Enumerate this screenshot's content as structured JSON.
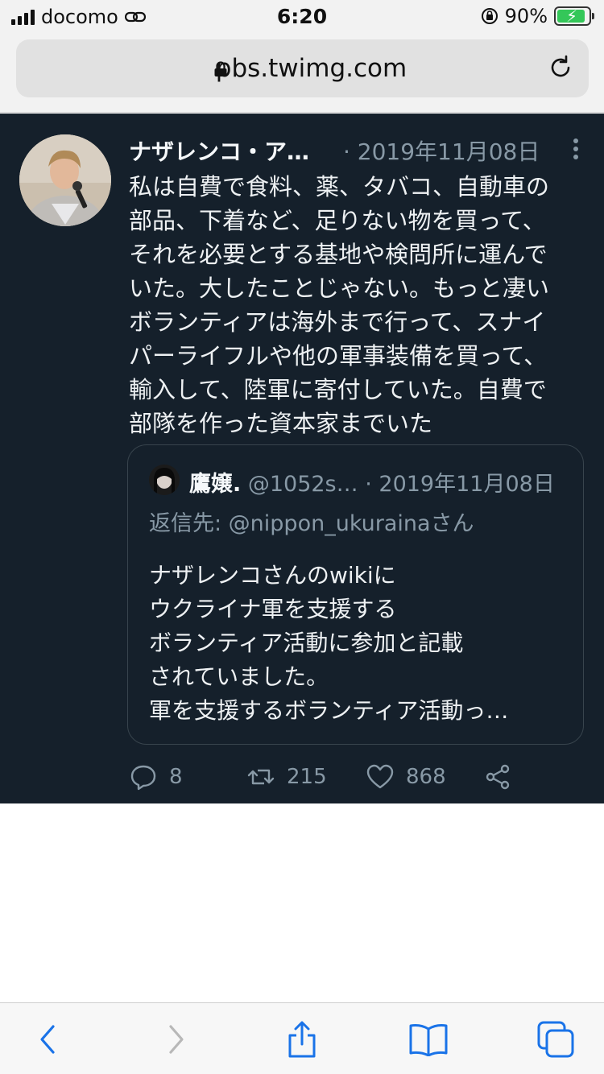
{
  "status_bar": {
    "carrier": "docomo",
    "time": "6:20",
    "battery_percent": "90%",
    "battery_level": 0.9,
    "colors": {
      "battery": "#34c759"
    }
  },
  "browser": {
    "url": "pbs.twimg.com"
  },
  "tweet": {
    "author_name": "ナザレンコ・ア…",
    "date": "· 2019年11月08日",
    "body": "私は自費で食料、薬、タバコ、自動車の\n部品、下着など、足りない物を買って、\nそれを必要とする基地や検問所に運んで\nいた。大したことじゃない。もっと凄い\nボランティアは海外まで行って、スナイ\nパーライフルや他の軍事装備を買って、\n輸入して、陸軍に寄付していた。自費で\n部隊を作った資本家までいた",
    "quote": {
      "author_name": "鷹嬢.",
      "handle": " @1052s…",
      "date": " · 2019年11月08日",
      "reply_to": "返信先: @nippon_ukurainaさん",
      "body": "ナザレンコさんのwikiに\nウクライナ軍を支援する\nボランティア活動に参加と記載\nされていました。\n軍を支援するボランティア活動っ…"
    },
    "actions": {
      "replies": "8",
      "retweets": "215",
      "likes": "868"
    },
    "colors": {
      "background": "#15202b",
      "secondary_text": "#8899a6",
      "border": "#38444d"
    }
  },
  "toolbar": {
    "icons": [
      "back-icon",
      "forward-icon",
      "share-icon",
      "bookmarks-icon",
      "tabs-icon"
    ],
    "colors": {
      "active": "#1a73e8",
      "disabled": "#b8b8b8"
    }
  }
}
